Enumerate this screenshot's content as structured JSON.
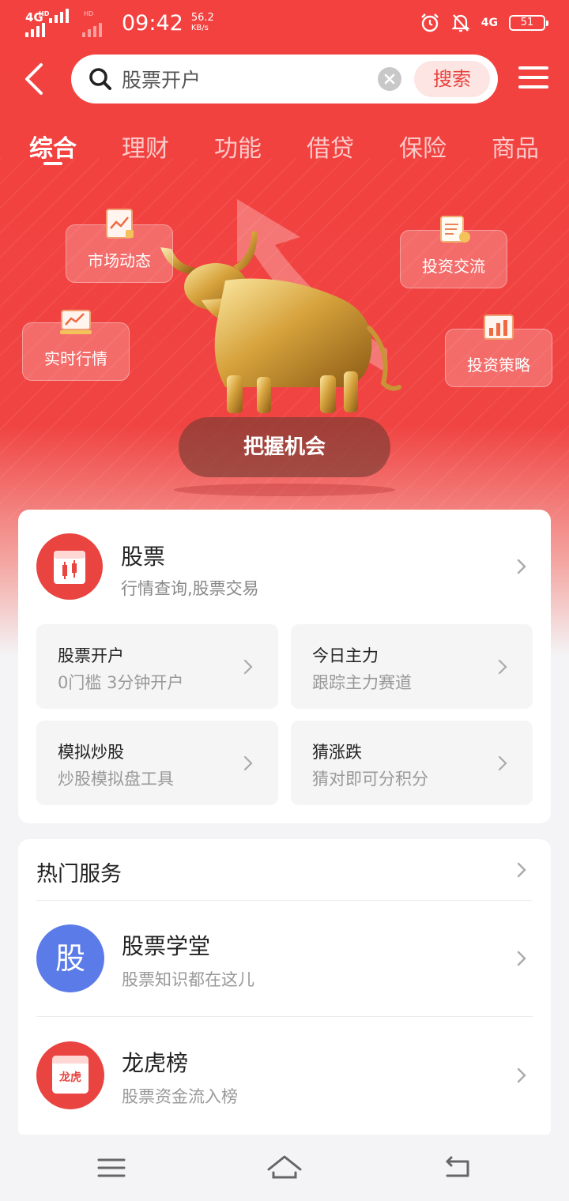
{
  "status_bar": {
    "net1": "4G",
    "net1_super": "HD",
    "net2_super": "HD",
    "time": "09:42",
    "speed_value": "56.2",
    "speed_unit": "KB/s",
    "net_right": "4G",
    "battery": "51"
  },
  "search": {
    "query": "股票开户",
    "button_label": "搜索"
  },
  "tabs": [
    {
      "label": "综合",
      "active": true
    },
    {
      "label": "理财",
      "active": false
    },
    {
      "label": "功能",
      "active": false
    },
    {
      "label": "借贷",
      "active": false
    },
    {
      "label": "保险",
      "active": false
    },
    {
      "label": "商品",
      "active": false
    }
  ],
  "hero": {
    "cards": [
      {
        "label": "市场动态"
      },
      {
        "label": "投资交流"
      },
      {
        "label": "实时行情"
      },
      {
        "label": "投资策略"
      }
    ],
    "cta_label": "把握机会"
  },
  "stock_card": {
    "title": "股票",
    "subtitle": "行情查询,股票交易",
    "tiles": [
      {
        "title": "股票开户",
        "subtitle": "0门槛 3分钟开户"
      },
      {
        "title": "今日主力",
        "subtitle": "跟踪主力赛道"
      },
      {
        "title": "模拟炒股",
        "subtitle": "炒股模拟盘工具"
      },
      {
        "title": "猜涨跌",
        "subtitle": "猜对即可分积分"
      }
    ]
  },
  "hot_services": {
    "title": "热门服务",
    "items": [
      {
        "title": "股票学堂",
        "subtitle": "股票知识都在这儿",
        "icon_text": "股",
        "icon_color": "#5b7be8"
      },
      {
        "title": "龙虎榜",
        "subtitle": "股票资金流入榜",
        "icon_text": "龙虎",
        "icon_color": "#e94440"
      }
    ]
  },
  "colors": {
    "brand_red": "#f2413f",
    "accent_blue": "#5b7be8"
  }
}
